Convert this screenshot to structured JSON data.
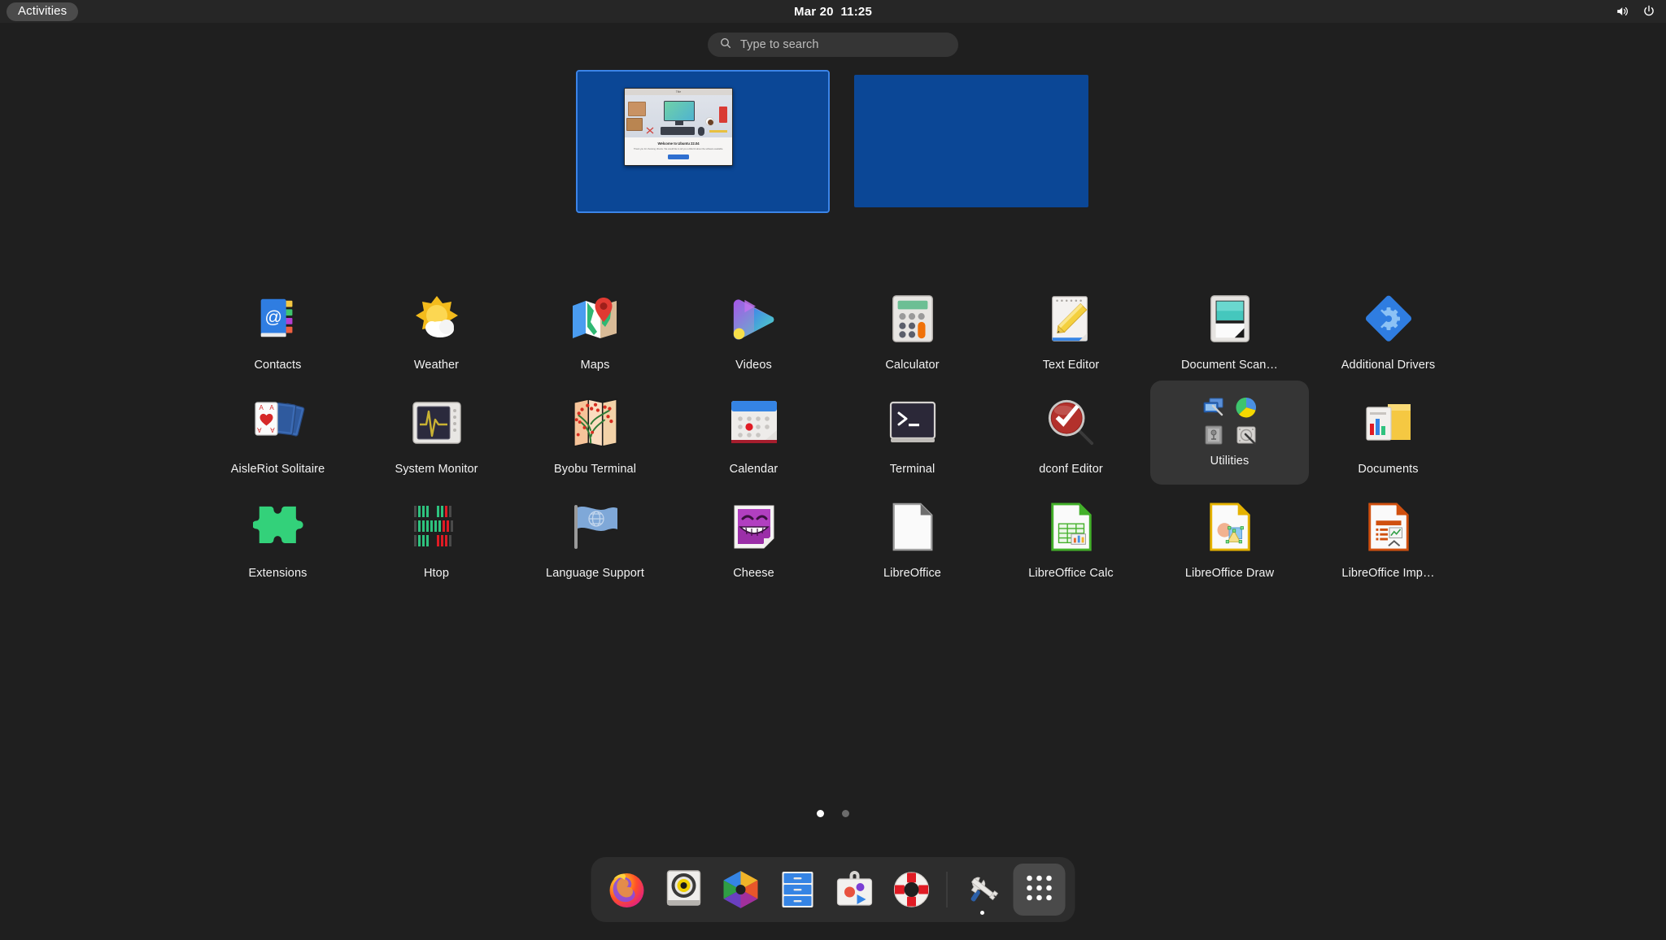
{
  "topbar": {
    "activities_label": "Activities",
    "clock": "Mar 20  11:25",
    "volume_icon": "speaker-icon",
    "power_icon": "power-icon"
  },
  "search": {
    "placeholder": "Type to search",
    "icon": "search-icon"
  },
  "workspaces": {
    "items": [
      {
        "name": "workspace-1",
        "active": true,
        "window": {
          "title": "Title",
          "heading": "Welcome to Ubuntu 22.04",
          "body": "Thank you for choosing Ubuntu. We would like to tell you a little bit about the software available.",
          "button": "Next"
        }
      },
      {
        "name": "workspace-2",
        "active": false
      }
    ]
  },
  "apps": {
    "rows": [
      [
        {
          "label": "Contacts",
          "icon": "contacts-icon"
        },
        {
          "label": "Weather",
          "icon": "weather-icon"
        },
        {
          "label": "Maps",
          "icon": "maps-icon"
        },
        {
          "label": "Videos",
          "icon": "videos-icon"
        },
        {
          "label": "Calculator",
          "icon": "calculator-icon"
        },
        {
          "label": "Text Editor",
          "icon": "text-editor-icon"
        },
        {
          "label": "Document Scan…",
          "icon": "document-scanner-icon"
        },
        {
          "label": "Additional Drivers",
          "icon": "additional-drivers-icon"
        }
      ],
      [
        {
          "label": "AisleRiot Solitaire",
          "icon": "aisleriot-solitaire-icon"
        },
        {
          "label": "System Monitor",
          "icon": "system-monitor-icon"
        },
        {
          "label": "Byobu Terminal",
          "icon": "byobu-terminal-icon"
        },
        {
          "label": "Calendar",
          "icon": "calendar-icon"
        },
        {
          "label": "Terminal",
          "icon": "terminal-icon"
        },
        {
          "label": "dconf Editor",
          "icon": "dconf-editor-icon"
        },
        {
          "label": "Utilities",
          "icon": "utilities-folder-icon",
          "folder": true
        },
        {
          "label": "Documents",
          "icon": "documents-icon"
        }
      ],
      [
        {
          "label": "Extensions",
          "icon": "extensions-icon"
        },
        {
          "label": "Htop",
          "icon": "htop-icon"
        },
        {
          "label": "Language Support",
          "icon": "language-support-icon"
        },
        {
          "label": "Cheese",
          "icon": "cheese-icon"
        },
        {
          "label": "LibreOffice",
          "icon": "libreoffice-icon"
        },
        {
          "label": "LibreOffice Calc",
          "icon": "libreoffice-calc-icon"
        },
        {
          "label": "LibreOffice Draw",
          "icon": "libreoffice-draw-icon"
        },
        {
          "label": "LibreOffice Imp…",
          "icon": "libreoffice-impress-icon"
        }
      ]
    ]
  },
  "pages": {
    "count": 2,
    "current": 1
  },
  "dock": {
    "items": [
      {
        "name": "firefox",
        "label": "Firefox",
        "running": false
      },
      {
        "name": "rhythmbox",
        "label": "Rhythmbox",
        "running": false
      },
      {
        "name": "shotwell",
        "label": "Shotwell",
        "running": false
      },
      {
        "name": "files",
        "label": "Files",
        "running": false
      },
      {
        "name": "ubuntu-software",
        "label": "Ubuntu Software",
        "running": false
      },
      {
        "name": "help",
        "label": "Help",
        "running": false
      },
      {
        "name": "settings",
        "label": "Settings",
        "running": true
      },
      {
        "name": "show-apps",
        "label": "Show Applications",
        "active": true
      }
    ]
  },
  "colors": {
    "background": "#1f1f1f",
    "topbar": "#262626",
    "workspace": "#0b4796",
    "accent": "#3b84e8",
    "folder_bg": "#353535",
    "dock_bg": "#2d2d2d"
  }
}
